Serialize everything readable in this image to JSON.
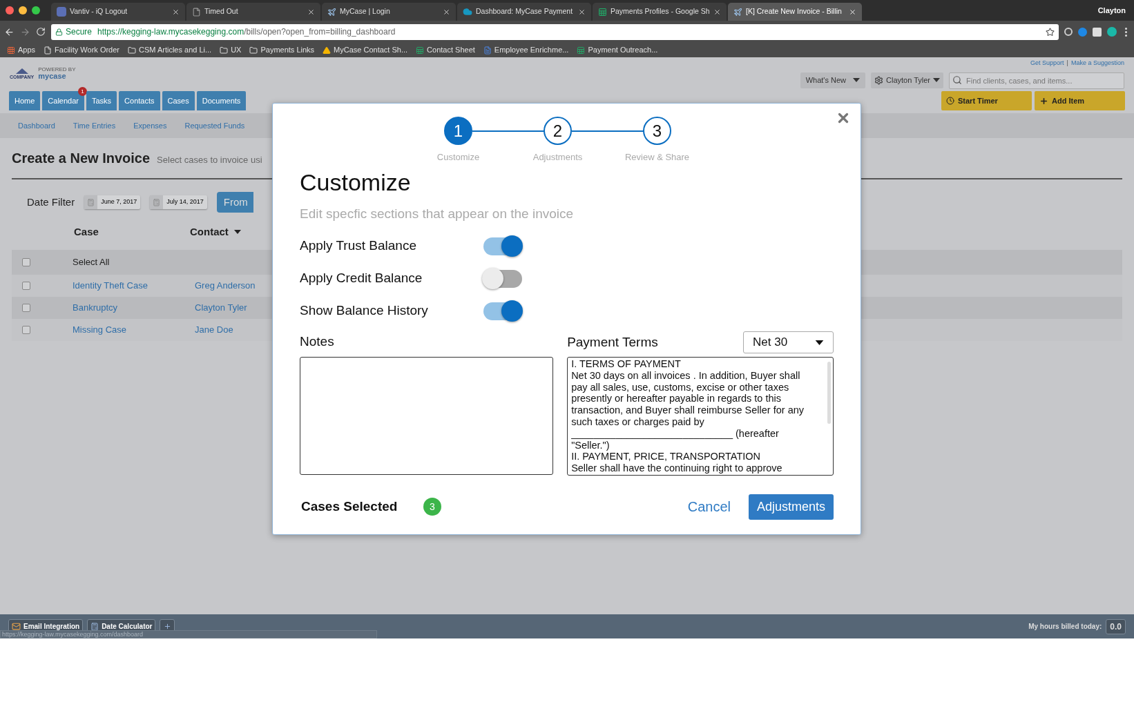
{
  "browser": {
    "tabs": [
      {
        "title": "Vantiv - iQ Logout",
        "selected": false,
        "kind": "iq"
      },
      {
        "title": "Timed Out",
        "selected": false,
        "kind": "page"
      },
      {
        "title": "MyCase | Login",
        "selected": false,
        "kind": "mycase"
      },
      {
        "title": "Dashboard: MyCase Payment",
        "selected": false,
        "kind": "cloud"
      },
      {
        "title": "Payments Profiles - Google Sh",
        "selected": false,
        "kind": "sheet"
      },
      {
        "title": "[K] Create New Invoice - Billin",
        "selected": true,
        "kind": "mycase"
      }
    ],
    "profile": "Clayton",
    "address": {
      "secure_label": "Secure",
      "url_host": "https://kegging-law.mycasekegging.com",
      "url_path": "/bills/open?open_from=billing_dashboard"
    },
    "bookmarks": [
      {
        "label": "Apps",
        "kind": "apps"
      },
      {
        "label": "Facility Work Order",
        "kind": "page"
      },
      {
        "label": "CSM Articles and Li...",
        "kind": "folder"
      },
      {
        "label": "UX",
        "kind": "folder"
      },
      {
        "label": "Payments Links",
        "kind": "folder"
      },
      {
        "label": "MyCase Contact Sh...",
        "kind": "drive"
      },
      {
        "label": "Contact Sheet",
        "kind": "sheet"
      },
      {
        "label": "Employee Enrichme...",
        "kind": "doc"
      },
      {
        "label": "Payment Outreach...",
        "kind": "sheet"
      }
    ]
  },
  "app": {
    "logo": {
      "company": "COMPANY",
      "powered_by": "POWERED BY",
      "brand": "mycase"
    },
    "header": {
      "get_support": "Get Support",
      "separator": "|",
      "make_suggestion": "Make a Suggestion",
      "whats_new": "What's New",
      "user": "Clayton Tyler",
      "search_placeholder": "Find clients, cases, and items..."
    },
    "nav_tabs": [
      {
        "label": "Home"
      },
      {
        "label": "Calendar",
        "badge": "1"
      },
      {
        "label": "Tasks"
      },
      {
        "label": "Contacts"
      },
      {
        "label": "Cases"
      },
      {
        "label": "Documents"
      }
    ],
    "actions": [
      {
        "label": "Start Timer",
        "kind": "timer"
      },
      {
        "label": "Add Item",
        "kind": "add"
      }
    ],
    "subnav": [
      "Dashboard",
      "Time Entries",
      "Expenses",
      "Requested Funds"
    ],
    "page": {
      "title": "Create a New Invoice",
      "subtitle": "Select cases to invoice usi",
      "date_filter_label": "Date Filter",
      "dates": [
        "June 7, 2017",
        "July 14, 2017"
      ],
      "from_button": "From"
    },
    "table": {
      "columns": [
        "Case",
        "Contact"
      ],
      "select_all": {
        "label": "Select All",
        "checked": false
      },
      "rows": [
        {
          "case": "Identity Theft Case",
          "contact": "Greg Anderson",
          "checked": false
        },
        {
          "case": "Bankruptcy",
          "contact": "Clayton Tyler",
          "checked": false
        },
        {
          "case": "Missing Case",
          "contact": "Jane Doe",
          "checked": false
        }
      ]
    }
  },
  "modal": {
    "steps": [
      {
        "number": "1",
        "label": "Customize",
        "selected": true
      },
      {
        "number": "2",
        "label": "Adjustments",
        "selected": false
      },
      {
        "number": "3",
        "label": "Review & Share",
        "selected": false
      }
    ],
    "title": "Customize",
    "subtitle": "Edit specfic sections that appear on the invoice",
    "toggles": [
      {
        "label": "Apply Trust Balance",
        "on": true
      },
      {
        "label": "Apply Credit Balance",
        "on": false
      },
      {
        "label": "Show Balance History",
        "on": true
      }
    ],
    "notes": {
      "label": "Notes"
    },
    "payment_terms": {
      "label": "Payment Terms",
      "select": "Net 30",
      "lines": [
        "I. TERMS OF PAYMENT",
        "Net 30 days on all invoices . In addition, Buyer shall",
        "pay all sales, use, customs, excise or other taxes",
        "presently or hereafter payable in regards to this",
        "transaction, and Buyer shall reimburse Seller for any",
        "such taxes or charges paid by",
        "_____________________________ (hereafter",
        "\"Seller.\")",
        "II. PAYMENT, PRICE, TRANSPORTATION",
        "Seller shall have the continuing right to approve"
      ]
    },
    "cases_selected": {
      "label": "Cases Selected",
      "count": "3"
    },
    "cancel": "Cancel",
    "next": "Adjustments"
  },
  "footer": {
    "buttons": [
      {
        "label": "Email Integration",
        "kind": "mail"
      },
      {
        "label": "Date Calculator",
        "kind": "calc"
      }
    ],
    "status_url": "https://kegging-law.mycasekegging.com/dashboard",
    "hours_label": "My hours billed today:",
    "hours_value": "0.0"
  }
}
